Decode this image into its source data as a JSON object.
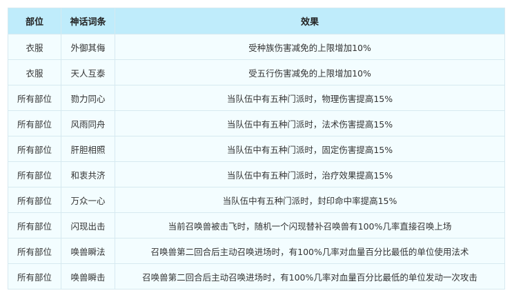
{
  "table": {
    "headers": [
      "部位",
      "神话词条",
      "效果"
    ],
    "rows": [
      [
        "衣服",
        "外御其侮",
        "受种族伤害减免的上限增加10%"
      ],
      [
        "衣服",
        "天人互泰",
        "受五行伤害减免的上限增加10%"
      ],
      [
        "所有部位",
        "勠力同心",
        "当队伍中有五种门派时，物理伤害提高15%"
      ],
      [
        "所有部位",
        "风雨同舟",
        "当队伍中有五种门派时，法术伤害提高15%"
      ],
      [
        "所有部位",
        "肝胆相照",
        "当队伍中有五种门派时，固定伤害提高15%"
      ],
      [
        "所有部位",
        "和衷共济",
        "当队伍中有五种门派时，治疗效果提高15%"
      ],
      [
        "所有部位",
        "万众一心",
        "当队伍中有五种门派时，封印命中率提高15%"
      ],
      [
        "所有部位",
        "闪现出击",
        "当前召唤兽被击飞时，随机一个闪现替补召唤兽有100%几率直接召唤上场"
      ],
      [
        "所有部位",
        "唤兽瞬法",
        "召唤兽第二回合后主动召唤进场时，有100%几率对血量百分比最低的单位使用法术"
      ],
      [
        "所有部位",
        "唤兽瞬击",
        "召唤兽第二回合后主动召唤进场时，有100%几率对血量百分比最低的单位发动一次攻击"
      ]
    ]
  }
}
